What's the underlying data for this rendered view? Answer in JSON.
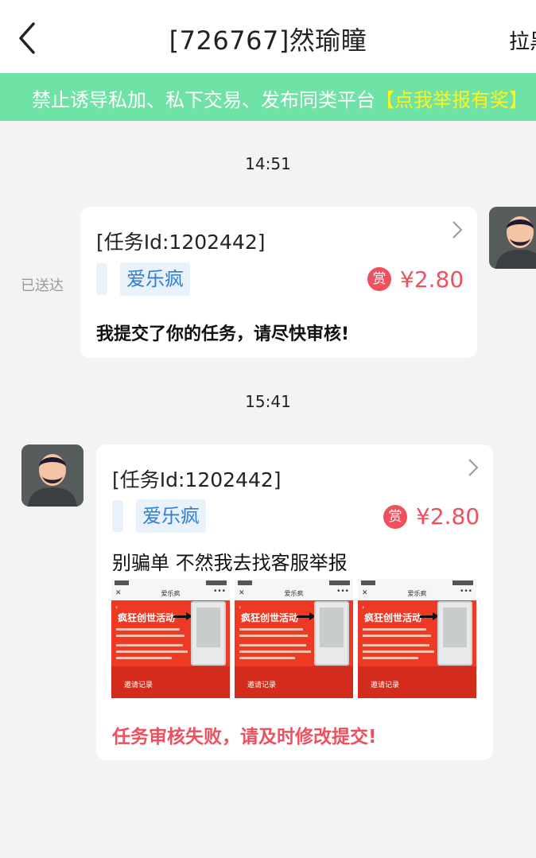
{
  "header": {
    "back_icon": "chevron-left-icon",
    "title": "[726767]然瑜瞳",
    "action_label": "拉黑"
  },
  "banner": {
    "text": "禁止诱导私加、私下交易、发布同类平台",
    "highlight": "【点我举报有奖】",
    "background": "#6fe2a6",
    "highlight_color": "#fff31a"
  },
  "messages": [
    {
      "time": "14:51",
      "sender": "self",
      "status": "已送达",
      "task_id": "[任务Id:1202442]",
      "tag": "爱乐疯",
      "reward_badge": "赏",
      "price": "¥2.80",
      "text": "我提交了你的任务，请尽快审核!"
    },
    {
      "time": "15:41",
      "sender": "other",
      "task_id": "[任务Id:1202442]",
      "tag": "爱乐疯",
      "reward_badge": "赏",
      "price": "¥2.80",
      "text": "别骗单 不然我去找客服举报",
      "images": [
        {
          "app_title": "爱乐疯",
          "headline": "疯狂创世活动",
          "tab": "邀请记录"
        },
        {
          "app_title": "爱乐疯",
          "headline": "疯狂创世活动",
          "tab": "邀请记录"
        },
        {
          "app_title": "爱乐疯",
          "headline": "疯狂创世活动",
          "tab": "邀请记录"
        }
      ],
      "status_text": "任务审核失败，请及时修改提交!"
    }
  ],
  "colors": {
    "accent_red": "#f0505e",
    "tag_blue": "#2b7fd4",
    "background": "#f3f3f3"
  }
}
